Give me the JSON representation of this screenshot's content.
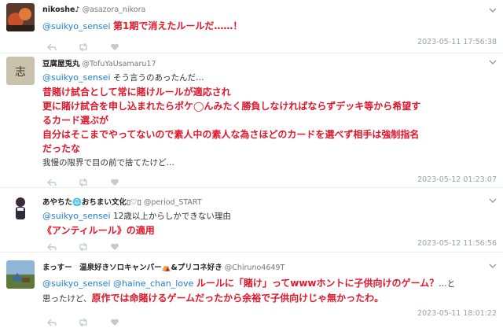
{
  "colors": {
    "mention": "#1d7fd0",
    "highlight": "#e0162b",
    "timestamp": "#9aa2a8"
  },
  "tweets": [
    {
      "name": "nikoshe",
      "name_suffix": "♪",
      "handle": "@asazora_nikora",
      "mention": "@suikyo_sensei",
      "text_red": "第1期で消えたルールだ……！",
      "time": "2023-05-11 17:56:38"
    },
    {
      "name": "豆腐屋兎丸",
      "handle": "@TofuYaUsamaru17",
      "mention": "@suikyo_sensei",
      "text_plain1": "そう言うのあったんだ…",
      "red1": "昔賭け試合として常に賭けルールが適応され",
      "red2": "更に賭け試合を申し込まれたらポケ◯んみたく勝負しなければならずデッキ等から希望す",
      "red3": "るカード選ぶが",
      "red4": "自分はそこまでやってないので素人中の素人な為さほどのカードを選べず相手は強制指名",
      "red5": "だったな",
      "text_plain2": "我慢の限界で目の前で捨てたけど…",
      "time": "2023-05-12 01:23:07"
    },
    {
      "name": "あやちた🌐おちまい文化▯♡▯",
      "handle": "@period_START",
      "mention": "@suikyo_sensei",
      "text_plain": "12歳以上からしかできない理由",
      "text_red": "《アンティルール》の適用",
      "time": "2023-05-12 11:56:56"
    },
    {
      "name": "まっすー　温泉好きソロキャンパー⛺&プリコネ好き",
      "handle": "@Chiruno4649T",
      "mention1": "@suikyo_sensei",
      "mention2": "@haine_chan_love",
      "text_red1": "ルールに「賭け」ってwwwホントに子供向けのゲーム？",
      "text_plain1": "…と",
      "text_plain2": "思ったけど、",
      "text_red2": "原作では命賭けるゲームだったから余裕で子供向けじゃ無かったわ。",
      "time": "2023-05-11 18:01:22"
    }
  ]
}
